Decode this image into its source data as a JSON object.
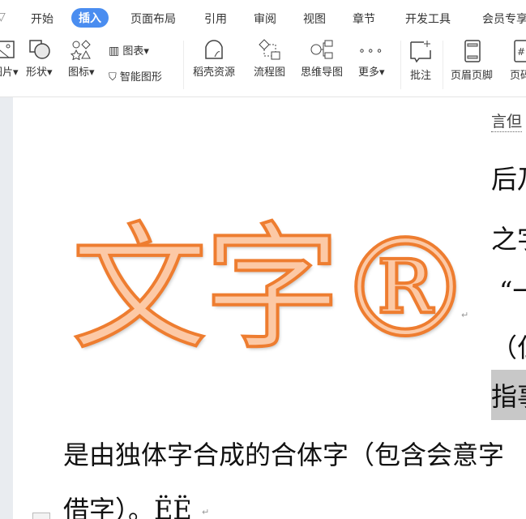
{
  "tabs": [
    "开始",
    "插入",
    "页面布局",
    "引用",
    "审阅",
    "视图",
    "章节",
    "开发工具",
    "会员专享"
  ],
  "active_tab": "插入",
  "tools": {
    "picture": "图片",
    "shape": "形状",
    "icon": "图标",
    "chart": "图表",
    "smart_art": "智能图形",
    "docer": "稻壳资源",
    "flowchart": "流程图",
    "mindmap": "思维导图",
    "more": "更多",
    "comment": "批注",
    "header_footer": "页眉页脚",
    "page_num": "页码"
  },
  "doc": {
    "art_text": "文字®",
    "right_lines": [
      "言但",
      "后乃",
      "之字",
      "“一",
      "（仁",
      "指事"
    ],
    "line1": "是由独体字合成的合体字（包含会意字",
    "line2": "借字）。ËË"
  },
  "colors": {
    "accent": "#4a8df0",
    "art_outline": "#ee7d30",
    "art_fill": "#fcc9a6"
  }
}
